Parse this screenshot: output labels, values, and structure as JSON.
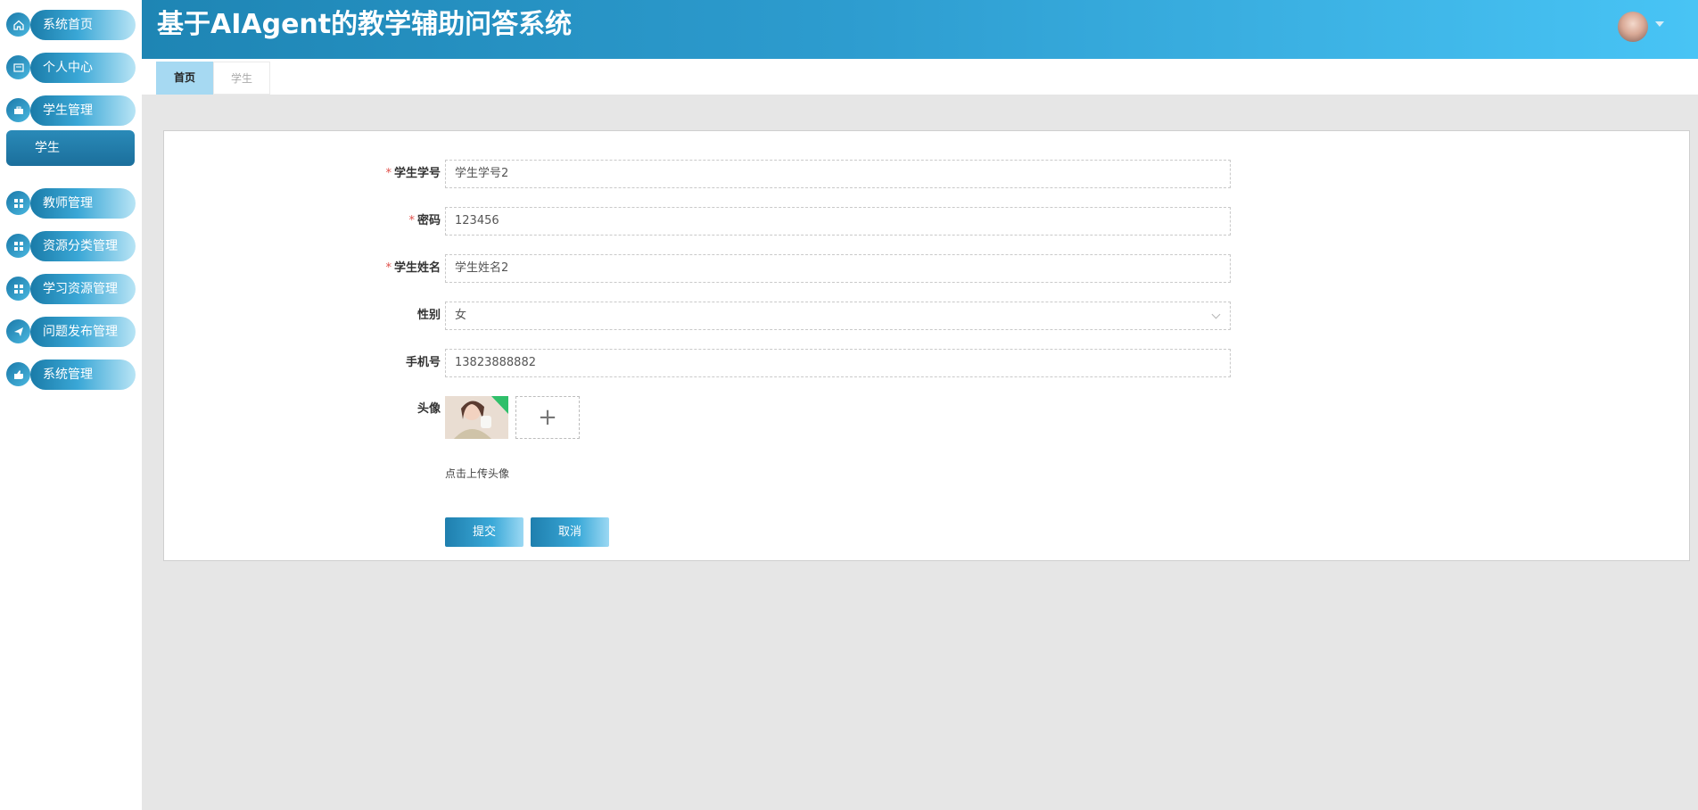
{
  "app": {
    "title": "基于AIAgent的教学辅助问答系统"
  },
  "sidebar": {
    "items": [
      {
        "label": "系统首页",
        "icon": "home-icon"
      },
      {
        "label": "个人中心",
        "icon": "id-card-icon"
      },
      {
        "label": "学生管理",
        "icon": "briefcase-icon"
      },
      {
        "label": "学生",
        "icon": ""
      },
      {
        "label": "教师管理",
        "icon": "grid-icon"
      },
      {
        "label": "资源分类管理",
        "icon": "grid-icon"
      },
      {
        "label": "学习资源管理",
        "icon": "grid-icon"
      },
      {
        "label": "问题发布管理",
        "icon": "paper-plane-icon"
      },
      {
        "label": "系统管理",
        "icon": "thumbs-up-icon"
      }
    ]
  },
  "tabs": [
    {
      "label": "首页",
      "active": true
    },
    {
      "label": "学生",
      "active": false
    }
  ],
  "form": {
    "student_id": {
      "label": "学生学号",
      "value": "学生学号2",
      "required": true
    },
    "password": {
      "label": "密码",
      "value": "123456",
      "required": true
    },
    "student_name": {
      "label": "学生姓名",
      "value": "学生姓名2",
      "required": true
    },
    "gender": {
      "label": "性别",
      "value": "女",
      "required": false
    },
    "phone": {
      "label": "手机号",
      "value": "13823888882",
      "required": false
    },
    "avatar": {
      "label": "头像",
      "upload_hint": "点击上传头像",
      "add_symbol": "+"
    },
    "submit_label": "提交",
    "cancel_label": "取消"
  },
  "colors": {
    "header_start": "#1e85b4",
    "header_end": "#48c4f5",
    "tab_active_bg": "#a6d9f2",
    "required_mark": "#e0504a",
    "page_bg": "#e6e6e6"
  }
}
